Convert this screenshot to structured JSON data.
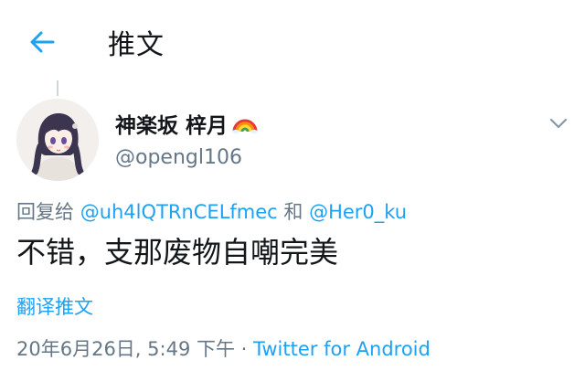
{
  "header": {
    "title": "推文"
  },
  "tweet": {
    "display_name": "神楽坂 梓月",
    "handle": "@opengl106",
    "reply_prefix": "回复给 ",
    "reply_mention_1": "@uh4lQTRnCELfmec",
    "reply_conjunction": " 和 ",
    "reply_mention_2": "@Her0_ku",
    "text": "不错，支那废物自嘲完美",
    "translate_label": "翻译推文",
    "timestamp": "20年6月26日, 5:49 下午",
    "separator": " · ",
    "source": "Twitter for Android"
  },
  "colors": {
    "accent": "#1da1f2",
    "secondary_text": "#657786",
    "primary_text": "#14171a"
  },
  "icons": {
    "back": "arrow-left-icon",
    "more": "chevron-down-icon",
    "emoji": "rainbow-emoji-icon"
  }
}
